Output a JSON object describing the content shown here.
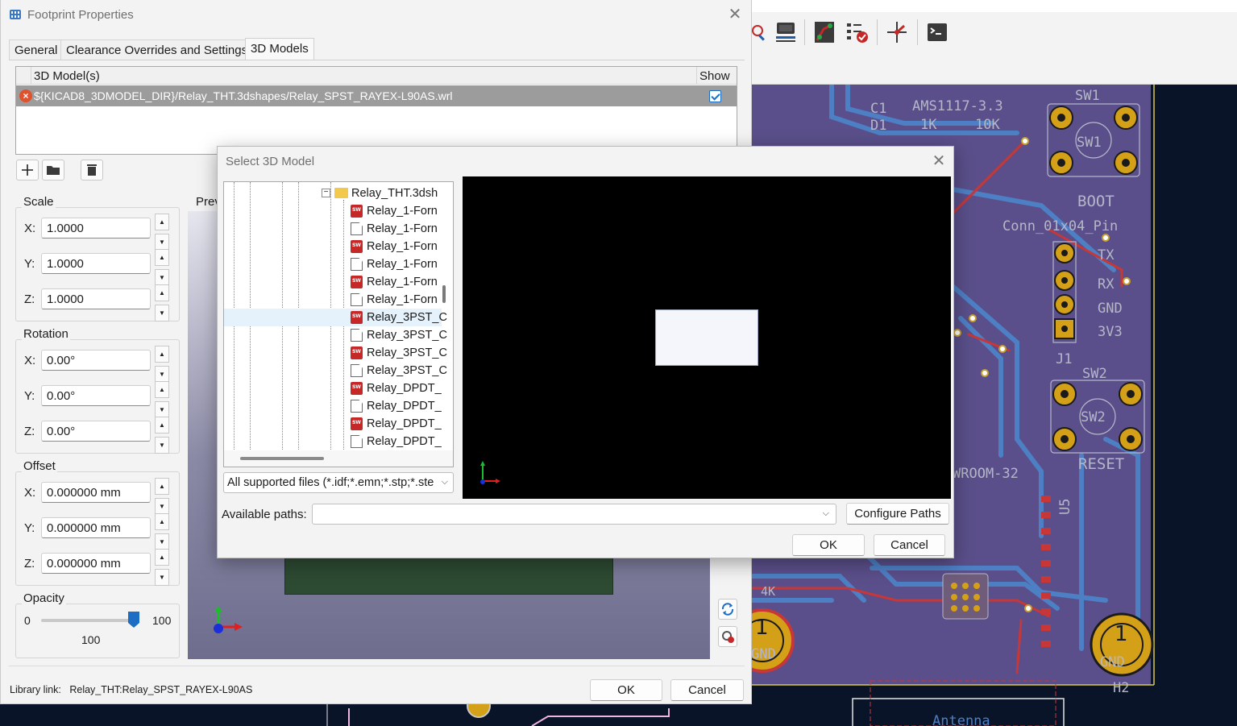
{
  "footprint_window": {
    "title": "Footprint Properties",
    "close": "✕",
    "tabs": [
      "General",
      "Clearance Overrides and Settings",
      "3D Models"
    ],
    "models_table": {
      "col_model": "3D Model(s)",
      "col_show": "Show",
      "rows": [
        {
          "path": "${KICAD8_3DMODEL_DIR}/Relay_THT.3dshapes/Relay_SPST_RAYEX-L90AS.wrl",
          "show": true,
          "status": "error"
        }
      ]
    },
    "scale": {
      "title": "Scale",
      "x_label": "X:",
      "y_label": "Y:",
      "z_label": "Z:",
      "x": "1.0000",
      "y": "1.0000",
      "z": "1.0000"
    },
    "rotation": {
      "title": "Rotation",
      "x_label": "X:",
      "y_label": "Y:",
      "z_label": "Z:",
      "x": "0.00°",
      "y": "0.00°",
      "z": "0.00°"
    },
    "offset": {
      "title": "Offset",
      "x_label": "X:",
      "y_label": "Y:",
      "z_label": "Z:",
      "x": "0.000000 mm",
      "y": "0.000000 mm",
      "z": "0.000000 mm"
    },
    "opacity": {
      "title": "Opacity",
      "min": "0",
      "max": "100",
      "value": "100",
      "level": 1.0
    },
    "preview_label": "Prev",
    "library_link_label": "Library link:",
    "library_link": "Relay_THT:Relay_SPST_RAYEX-L90AS",
    "ok": "OK",
    "cancel": "Cancel"
  },
  "select_dialog": {
    "title": "Select 3D Model",
    "close": "✕",
    "tree": {
      "folder": "Relay_THT.3dsh",
      "expander": "−",
      "files": [
        {
          "name": "Relay_1-Forn",
          "icon": "sw"
        },
        {
          "name": "Relay_1-Forn",
          "icon": "doc"
        },
        {
          "name": "Relay_1-Forn",
          "icon": "sw"
        },
        {
          "name": "Relay_1-Forn",
          "icon": "doc"
        },
        {
          "name": "Relay_1-Forn",
          "icon": "sw"
        },
        {
          "name": "Relay_1-Forn",
          "icon": "doc"
        },
        {
          "name": "Relay_3PST_C",
          "icon": "sw"
        },
        {
          "name": "Relay_3PST_C",
          "icon": "doc"
        },
        {
          "name": "Relay_3PST_C",
          "icon": "sw"
        },
        {
          "name": "Relay_3PST_C",
          "icon": "doc"
        },
        {
          "name": "Relay_DPDT_",
          "icon": "sw"
        },
        {
          "name": "Relay_DPDT_",
          "icon": "doc"
        },
        {
          "name": "Relay_DPDT_",
          "icon": "sw"
        },
        {
          "name": "Relay_DPDT_",
          "icon": "doc"
        }
      ]
    },
    "filter": "All supported files (*.idf;*.emn;*.stp;*.ste",
    "filter_chevron": "⌵",
    "paths_label": "Available paths:",
    "paths_value": "",
    "configure_paths": "Configure Paths",
    "ok": "OK",
    "cancel": "Cancel"
  },
  "pcb_editor": {
    "silkscreen": {
      "sw1": "SW1",
      "sw1_inner": "SW1",
      "boot": "BOOT",
      "conn": "Conn_01x04_Pin",
      "tx": "TX",
      "rx": "RX",
      "gnd": "GND",
      "v33": "3V3",
      "j1": "J1",
      "sw2": "SW2",
      "sw2_inner": "SW2",
      "reset": "RESET",
      "module": "WROOM-32",
      "u5": "U5",
      "c1": "C1",
      "d1": "D1",
      "ams": "AMS1117-3.3",
      "r1k": "1K",
      "r10k": "10K",
      "r4": "4K",
      "one_left": "1",
      "gnd_left": "GND",
      "one_right": "1",
      "gnd_right": "GND",
      "h2": "H2",
      "antenna": "Antenna"
    },
    "colors": {
      "copper_front": "#c83737",
      "copper_back": "#4d7fc4",
      "board": "#5a4f8a",
      "pad": "#d4a017"
    }
  }
}
